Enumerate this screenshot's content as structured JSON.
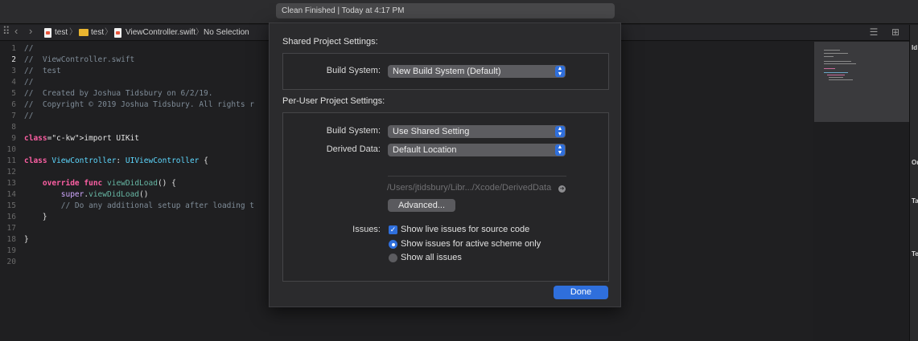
{
  "toolbar": {
    "activity_status": "Clean Finished | Today at 4:17 PM"
  },
  "jumpbar": {
    "back_icon": "chevron-left-icon",
    "forward_icon": "chevron-right-icon",
    "crumbs": [
      "test",
      "test",
      "ViewController.swift",
      "No Selection"
    ],
    "separator": "〉"
  },
  "editor": {
    "line_numbers": [
      "1",
      "2",
      "3",
      "4",
      "5",
      "6",
      "7",
      "8",
      "9",
      "10",
      "11",
      "12",
      "13",
      "14",
      "15",
      "16",
      "17",
      "18",
      "19",
      "20"
    ],
    "current_line": "2",
    "lines": [
      "//",
      "//  ViewController.swift",
      "//  test",
      "//",
      "//  Created by Joshua Tidsbury on 6/2/19.",
      "//  Copyright © 2019 Joshua Tidsbury. All rights r",
      "//",
      "",
      "import UIKit",
      "",
      "class ViewController: UIViewController {",
      "",
      "    override func viewDidLoad() {",
      "        super.viewDidLoad()",
      "        // Do any additional setup after loading t",
      "    }",
      "",
      "}",
      "",
      ""
    ]
  },
  "inspector": {
    "labels": [
      "Id",
      "Or",
      "Ta",
      "Te"
    ]
  },
  "dialog": {
    "shared_title": "Shared Project Settings:",
    "shared_build_system_label": "Build System:",
    "shared_build_system_value": "New Build System (Default)",
    "per_user_title": "Per-User Project Settings:",
    "user_build_system_label": "Build System:",
    "user_build_system_value": "Use Shared Setting",
    "derived_data_label": "Derived Data:",
    "derived_data_value": "Default Location",
    "derived_data_path": "/Users/jtidsbury/Libr.../Xcode/DerivedData",
    "advanced_button": "Advanced...",
    "issues_label": "Issues:",
    "issues_options": [
      {
        "label": "Show live issues for source code",
        "kind": "checkbox",
        "checked": true
      },
      {
        "label": "Show issues for active scheme only",
        "kind": "radio",
        "checked": true
      },
      {
        "label": "Show all issues",
        "kind": "radio",
        "checked": false
      }
    ],
    "done_button": "Done"
  },
  "colors": {
    "accent": "#2f6fdc",
    "sheet_bg": "#2b2b2d",
    "editor_bg": "#1f1f21",
    "keyword": "#fc5fa3",
    "type": "#5dd8ff",
    "comment": "#7f8c98"
  }
}
